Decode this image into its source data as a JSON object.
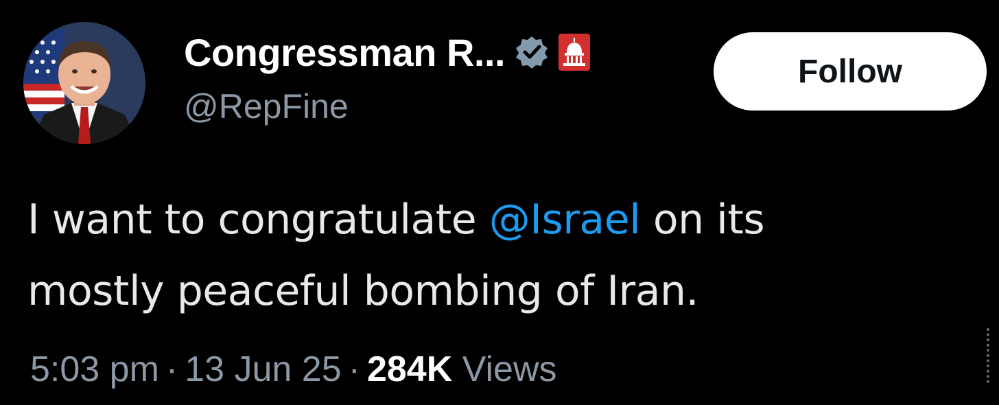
{
  "author": {
    "display_name": "Congressman R...",
    "handle": "@RepFine",
    "verified_icon": "verified-badge-icon",
    "affiliation_icon": "capitol-dome-icon"
  },
  "follow_button": {
    "label": "Follow"
  },
  "tweet": {
    "text_before_mention": "I want to congratulate ",
    "mention": "@Israel",
    "text_after_mention": " on its",
    "line2": "mostly peaceful bombing of Iran."
  },
  "meta": {
    "time": "5:03 pm",
    "separator": "·",
    "date": "13 Jun 25",
    "views_count": "284K",
    "views_label": "Views"
  },
  "colors": {
    "background": "#000000",
    "text": "#e7e9ea",
    "secondary_text": "#8b98a5",
    "mention": "#1d9bf0",
    "verified_gray": "#829aab",
    "gov_badge_red": "#d32f2f"
  }
}
